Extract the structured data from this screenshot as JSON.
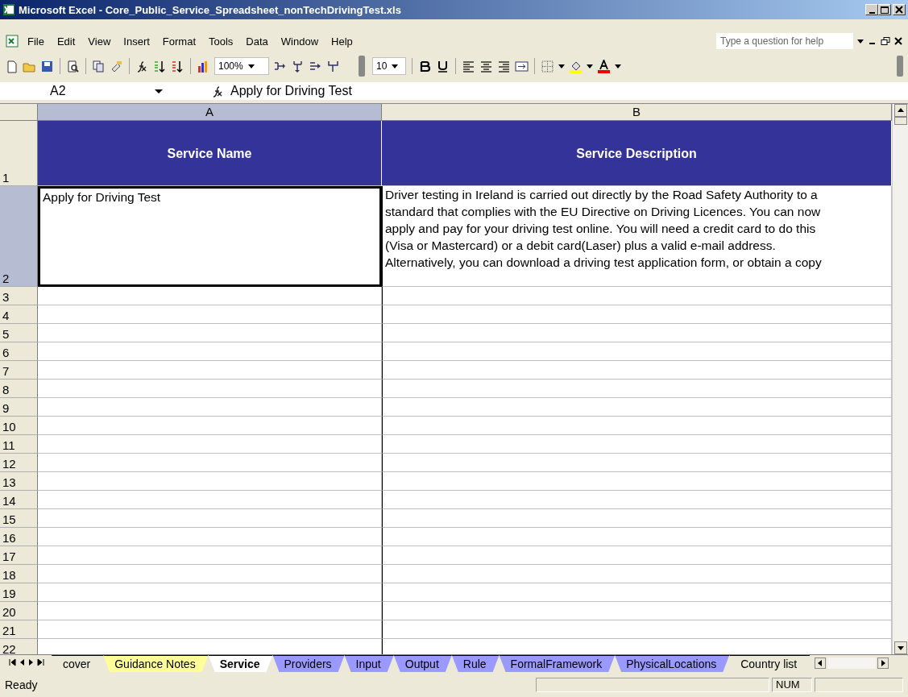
{
  "window": {
    "title": "Microsoft Excel - Core_Public_Service_Spreadsheet_nonTechDrivingTest.xls"
  },
  "menu": [
    {
      "label": "File"
    },
    {
      "label": "Edit"
    },
    {
      "label": "View"
    },
    {
      "label": "Insert"
    },
    {
      "label": "Format"
    },
    {
      "label": "Tools"
    },
    {
      "label": "Data"
    },
    {
      "label": "Window"
    },
    {
      "label": "Help"
    }
  ],
  "help_box": {
    "placeholder": "Type a question for help"
  },
  "toolbar": {
    "zoom": "100%",
    "font_size": "10"
  },
  "formula_bar": {
    "name_box": "A2",
    "formula": "Apply for Driving Test"
  },
  "columns": [
    {
      "label": "A",
      "selected": true
    },
    {
      "label": "B",
      "selected": false
    }
  ],
  "rows": [
    {
      "label": "1",
      "selected": false,
      "kind": "header",
      "cells": [
        "Service Name",
        "Service Description"
      ]
    },
    {
      "label": "2",
      "selected": true,
      "kind": "data",
      "cells": [
        "Apply for Driving Test",
        "Driver testing in Ireland is carried out directly by the Road Safety Authority to a\nstandard that complies with the EU Directive on Driving Licences. You can now\napply and pay for your driving test online. You will need a credit card to do this\n(Visa or Mastercard) or a debit card(Laser) plus a valid e-mail address.\nAlternatively, you can download a driving test application form, or obtain a copy"
      ]
    },
    {
      "label": "3",
      "selected": false,
      "kind": "empty"
    },
    {
      "label": "4",
      "selected": false,
      "kind": "empty"
    },
    {
      "label": "5",
      "selected": false,
      "kind": "empty"
    },
    {
      "label": "6",
      "selected": false,
      "kind": "empty"
    },
    {
      "label": "7",
      "selected": false,
      "kind": "empty"
    },
    {
      "label": "8",
      "selected": false,
      "kind": "empty"
    },
    {
      "label": "9",
      "selected": false,
      "kind": "empty"
    },
    {
      "label": "10",
      "selected": false,
      "kind": "empty"
    },
    {
      "label": "11",
      "selected": false,
      "kind": "empty"
    },
    {
      "label": "12",
      "selected": false,
      "kind": "empty"
    },
    {
      "label": "13",
      "selected": false,
      "kind": "empty"
    },
    {
      "label": "14",
      "selected": false,
      "kind": "empty"
    },
    {
      "label": "15",
      "selected": false,
      "kind": "empty"
    },
    {
      "label": "16",
      "selected": false,
      "kind": "empty"
    },
    {
      "label": "17",
      "selected": false,
      "kind": "empty"
    },
    {
      "label": "18",
      "selected": false,
      "kind": "empty"
    },
    {
      "label": "19",
      "selected": false,
      "kind": "empty"
    },
    {
      "label": "20",
      "selected": false,
      "kind": "empty"
    },
    {
      "label": "21",
      "selected": false,
      "kind": "empty"
    },
    {
      "label": "22",
      "selected": false,
      "kind": "empty"
    }
  ],
  "sheet_tabs": [
    {
      "label": "cover",
      "selected": false,
      "color": "#ece9d8"
    },
    {
      "label": "Guidance Notes",
      "selected": false,
      "color": "#ffff99"
    },
    {
      "label": "Service",
      "selected": true,
      "color": "#ffffff"
    },
    {
      "label": "Providers",
      "selected": false,
      "color": "#9999ff"
    },
    {
      "label": "Input",
      "selected": false,
      "color": "#9999ff"
    },
    {
      "label": "Output",
      "selected": false,
      "color": "#9999ff"
    },
    {
      "label": "Rule",
      "selected": false,
      "color": "#9999ff"
    },
    {
      "label": "FormalFramework",
      "selected": false,
      "color": "#9999ff"
    },
    {
      "label": "PhysicalLocations",
      "selected": false,
      "color": "#9999ff"
    },
    {
      "label": "Country list",
      "selected": false,
      "color": "#ece9d8"
    }
  ],
  "status_bar": {
    "text": "Ready",
    "indicators": [
      "NUM"
    ]
  }
}
